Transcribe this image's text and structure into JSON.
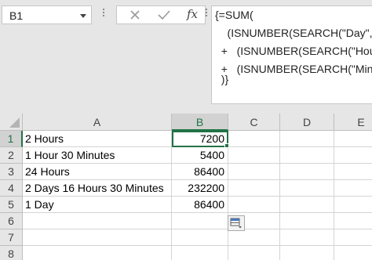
{
  "name_box": {
    "value": "B1"
  },
  "formula_bar": {
    "cancel_icon": "close-icon",
    "enter_icon": "check-icon",
    "fx_label": "fx",
    "lines": [
      "{=SUM(",
      "    (ISNUMBER(SEARCH(\"Day\",",
      "  +   (ISNUMBER(SEARCH(\"Hour",
      "  +   (ISNUMBER(SEARCH(\"Minu",
      "  )}"
    ]
  },
  "columns": [
    "A",
    "B",
    "C",
    "D",
    "E"
  ],
  "selected_column": "B",
  "rows": [
    {
      "num": "1",
      "a": "2 Hours",
      "b": "7200"
    },
    {
      "num": "2",
      "a": "1 Hour 30 Minutes",
      "b": "5400"
    },
    {
      "num": "3",
      "a": "24 Hours",
      "b": "86400"
    },
    {
      "num": "4",
      "a": "2 Days 16 Hours 30 Minutes",
      "b": "232200"
    },
    {
      "num": "5",
      "a": "1 Day",
      "b": "86400"
    },
    {
      "num": "6",
      "a": "",
      "b": ""
    },
    {
      "num": "7",
      "a": "",
      "b": ""
    },
    {
      "num": "8",
      "a": "",
      "b": ""
    }
  ],
  "selected_row": "1",
  "accent_color": "#217346",
  "quick_analysis_icon": "quick-analysis-icon"
}
